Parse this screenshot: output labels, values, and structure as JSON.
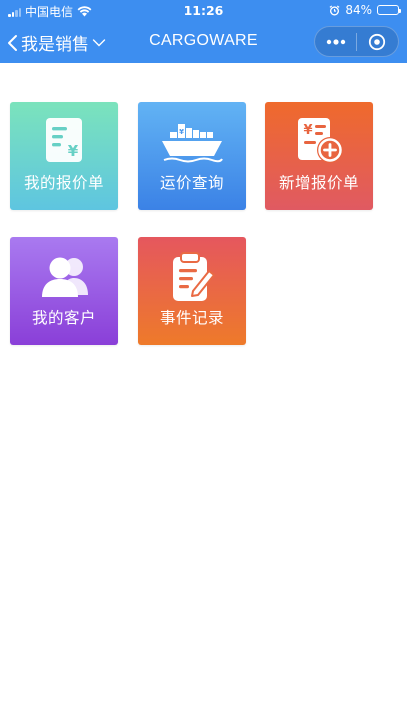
{
  "status_bar": {
    "carrier": "中国电信",
    "time": "11:26",
    "battery_percent": "84%",
    "battery_level": 0.84
  },
  "nav": {
    "back_label": "我是销售",
    "title": "CARGOWARE"
  },
  "tiles": [
    {
      "label": "我的报价单",
      "icon": "quote-document-icon"
    },
    {
      "label": "运价查询",
      "icon": "cargo-ship-icon"
    },
    {
      "label": "新增报价单",
      "icon": "add-quote-icon"
    },
    {
      "label": "我的客户",
      "icon": "customers-icon"
    },
    {
      "label": "事件记录",
      "icon": "clipboard-edit-icon"
    }
  ],
  "colors": {
    "primary": "#3d8ef0",
    "tile_quote": "#6ed4cc",
    "tile_freight": "#4a97ec",
    "tile_new_quote": "#e8643f",
    "tile_customers": "#9a5ce4",
    "tile_events": "#e96a44"
  }
}
